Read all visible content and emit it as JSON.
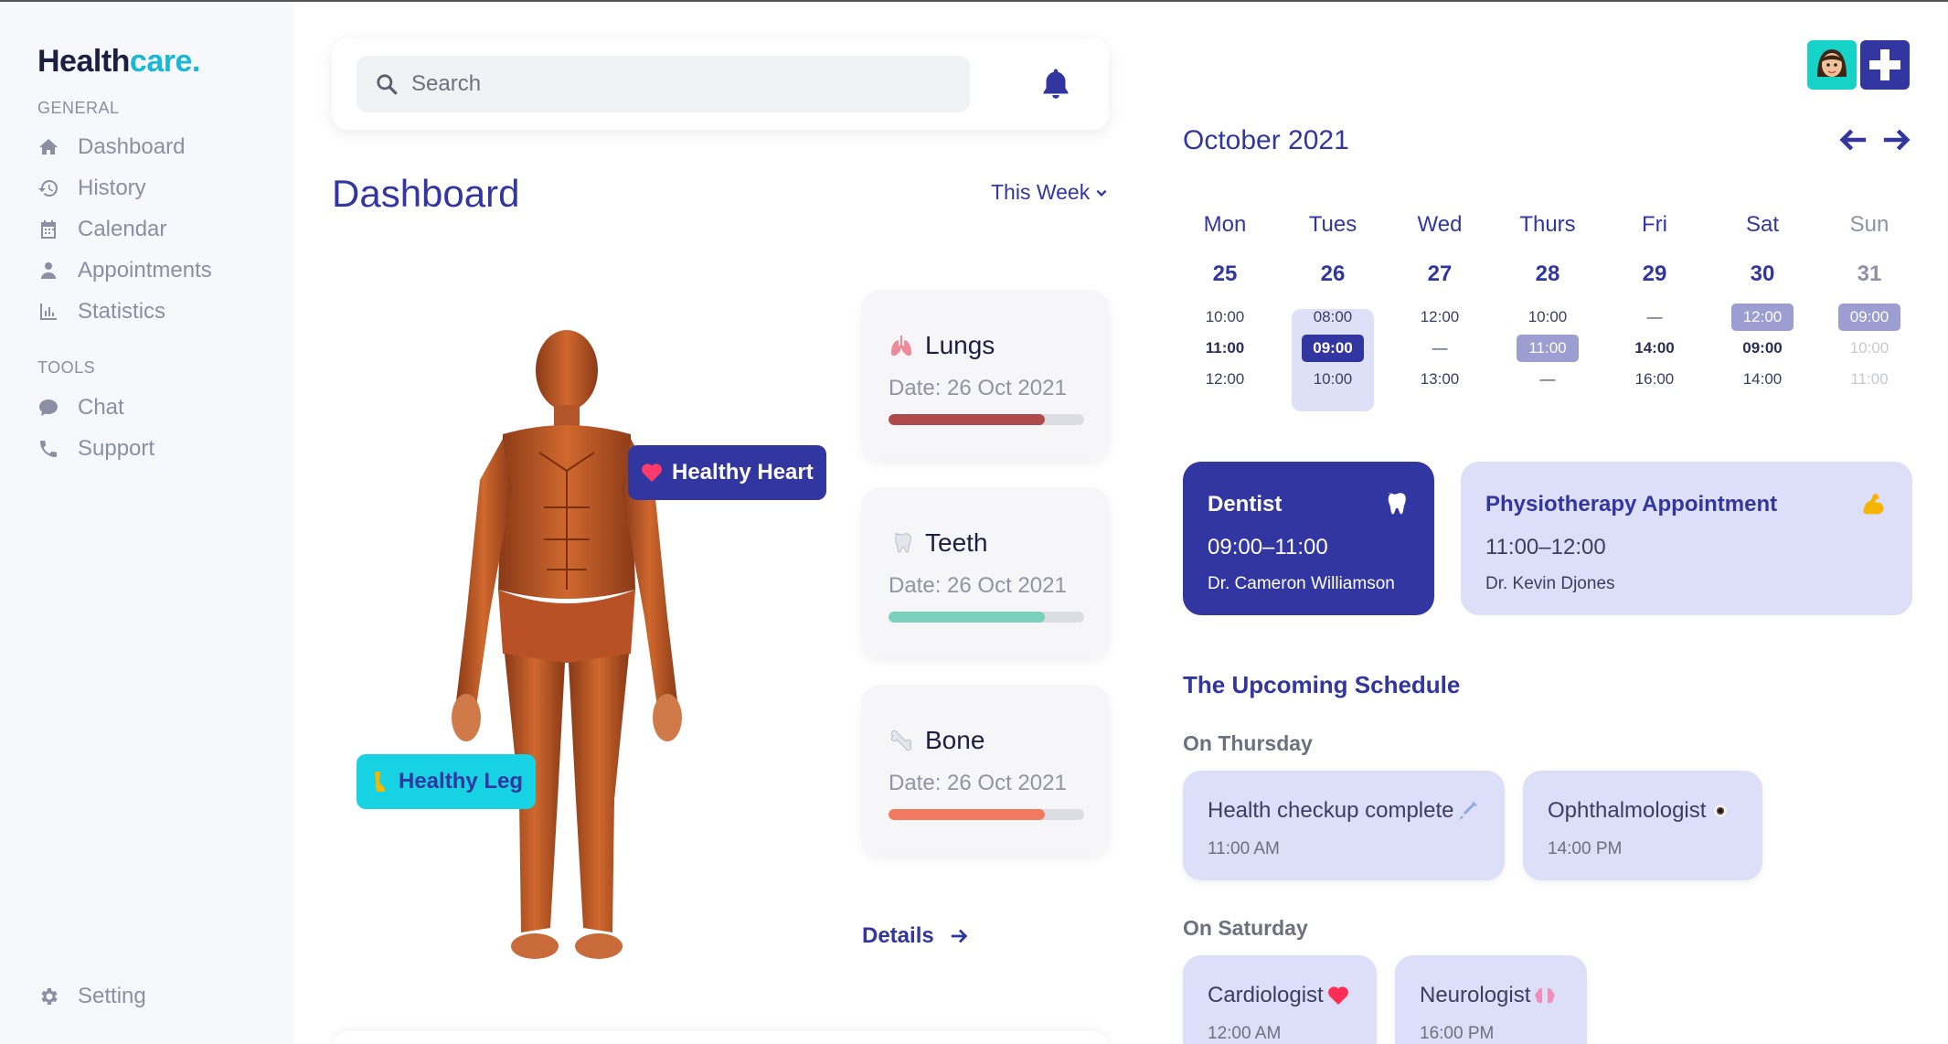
{
  "brand": {
    "name": "Health",
    "accent": "care."
  },
  "sidebar": {
    "general_label": "GENERAL",
    "tools_label": "TOOLS",
    "items": [
      {
        "label": "Dashboard",
        "icon": "home-icon"
      },
      {
        "label": "History",
        "icon": "history-icon"
      },
      {
        "label": "Calendar",
        "icon": "calendar-icon"
      },
      {
        "label": "Appointments",
        "icon": "doctor-icon"
      },
      {
        "label": "Statistics",
        "icon": "chart-icon"
      }
    ],
    "tools": [
      {
        "label": "Chat",
        "icon": "chat-icon"
      },
      {
        "label": "Support",
        "icon": "phone-icon"
      }
    ],
    "setting": {
      "label": "Setting",
      "icon": "gear-icon"
    }
  },
  "search": {
    "placeholder": "Search"
  },
  "dashboard": {
    "title": "Dashboard",
    "period": "This Week",
    "tags": {
      "heart": "Healthy Heart",
      "leg": "Healthy Leg"
    },
    "organs": [
      {
        "name": "Lungs",
        "date": "Date: 26 Oct 2021",
        "progress": 0.8,
        "color": "#b04a4a",
        "icon": "lungs-icon"
      },
      {
        "name": "Teeth",
        "date": "Date: 26 Oct 2021",
        "progress": 0.8,
        "color": "#7ad1bd",
        "icon": "tooth-icon"
      },
      {
        "name": "Bone",
        "date": "Date: 26 Oct 2021",
        "progress": 0.8,
        "color": "#f27a5e",
        "icon": "bone-icon"
      }
    ],
    "details_label": "Details"
  },
  "calendar": {
    "month": "October 2021",
    "days": [
      {
        "name": "Mon",
        "num": "25",
        "slots": [
          "10:00",
          "11:00",
          "12:00"
        ]
      },
      {
        "name": "Tues",
        "num": "26",
        "slots": [
          "08:00",
          "09:00",
          "10:00"
        ]
      },
      {
        "name": "Wed",
        "num": "27",
        "slots": [
          "12:00",
          "—",
          "13:00"
        ]
      },
      {
        "name": "Thurs",
        "num": "28",
        "slots": [
          "10:00",
          "11:00",
          "—"
        ]
      },
      {
        "name": "Fri",
        "num": "29",
        "slots": [
          "—",
          "14:00",
          "16:00"
        ]
      },
      {
        "name": "Sat",
        "num": "30",
        "slots": [
          "12:00",
          "09:00",
          "14:00"
        ]
      },
      {
        "name": "Sun",
        "num": "31",
        "slots": [
          "09:00",
          "10:00",
          "11:00"
        ]
      }
    ]
  },
  "appointments": [
    {
      "title": "Dentist",
      "time": "09:00–11:00",
      "doctor": "Dr. Cameron Williamson",
      "icon": "tooth-icon"
    },
    {
      "title": "Physiotherapy Appointment",
      "time": "11:00–12:00",
      "doctor": "Dr. Kevin Djones",
      "icon": "flexed-arm-icon"
    }
  ],
  "schedule": {
    "title": "The Upcoming Schedule",
    "thursday_label": "On Thursday",
    "saturday_label": "On Saturday",
    "thursday": [
      {
        "title": "Health checkup complete",
        "time": "11:00 AM",
        "icon": "syringe-icon"
      },
      {
        "title": "Ophthalmologist",
        "time": "14:00 PM",
        "icon": "eye-icon"
      }
    ],
    "saturday": [
      {
        "title": "Cardiologist",
        "time": "12:00 AM",
        "icon": "heart-icon"
      },
      {
        "title": "Neurologist",
        "time": "16:00 PM",
        "icon": "brain-icon"
      }
    ]
  },
  "colors": {
    "primary": "#3236a0",
    "accent": "#1ab7d6",
    "cyan": "#17d2e3",
    "card": "#dcdff7"
  }
}
